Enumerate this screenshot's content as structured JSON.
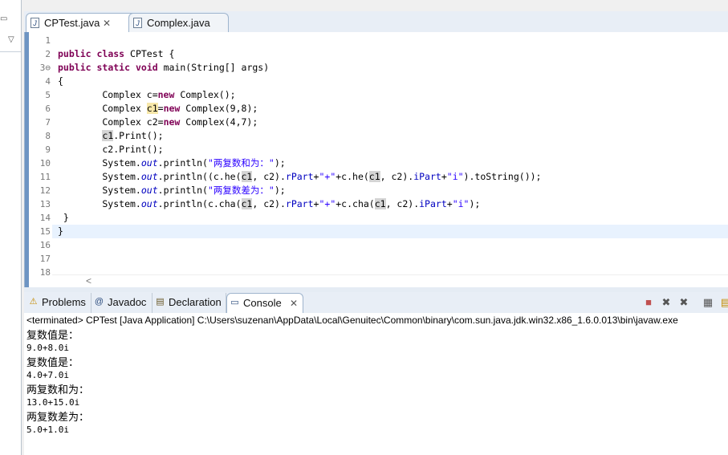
{
  "editor_tabs": [
    {
      "label": "CPTest.java",
      "active": true,
      "close": "✕"
    },
    {
      "label": "Complex.java",
      "active": false
    }
  ],
  "code_lines": [
    {
      "n": "1"
    },
    {
      "n": "2"
    },
    {
      "n": "3⊖"
    },
    {
      "n": "4"
    },
    {
      "n": "5"
    },
    {
      "n": "6"
    },
    {
      "n": "7"
    },
    {
      "n": "8"
    },
    {
      "n": "9"
    },
    {
      "n": "10"
    },
    {
      "n": "11"
    },
    {
      "n": "12"
    },
    {
      "n": "13"
    },
    {
      "n": "14"
    },
    {
      "n": "15"
    },
    {
      "n": "16"
    },
    {
      "n": "17"
    },
    {
      "n": "18"
    }
  ],
  "code": {
    "l2": [
      "public",
      " ",
      "class",
      " CPTest {"
    ],
    "l3": [
      "public",
      " ",
      "static",
      " ",
      "void",
      " main(String[] args)"
    ],
    "l4": "{",
    "l5": [
      "        Complex c=",
      "new",
      " Complex();"
    ],
    "l6": [
      "        Complex ",
      "c1",
      "=",
      "new",
      " Complex(9,8);"
    ],
    "l7": [
      "        Complex c2=",
      "new",
      " Complex(4,7);"
    ],
    "l8": [
      "        ",
      "c1",
      ".Print();"
    ],
    "l9": "        c2.Print();",
    "l10": [
      "        System.",
      "out",
      ".println(",
      "\"两复数和为：\"",
      ");"
    ],
    "l11": [
      "        System.",
      "out",
      ".println((c.he(",
      "c1",
      ", c2).",
      "rPart",
      "+",
      "\"+\"",
      "+c.he(",
      "c1",
      ", c2).",
      "iPart",
      "+",
      "\"i\"",
      ").toString());"
    ],
    "l12": [
      "        System.",
      "out",
      ".println(",
      "\"两复数差为：\"",
      ");"
    ],
    "l13": [
      "        System.",
      "out",
      ".println(c.cha(",
      "c1",
      ", c2).",
      "rPart",
      "+",
      "\"+\"",
      "+c.cha(",
      "c1",
      ", c2).",
      "iPart",
      "+",
      "\"i\"",
      ");"
    ],
    "l14": " }",
    "l15": "}"
  },
  "scroll_marker": "<",
  "console_tabs": [
    {
      "label": "Problems",
      "icon": "problems-icon",
      "glyph": "⚠"
    },
    {
      "label": "Javadoc",
      "icon": "javadoc-icon",
      "glyph": "@"
    },
    {
      "label": "Declaration",
      "icon": "declaration-icon",
      "glyph": "▤"
    },
    {
      "label": "Console",
      "icon": "console-icon",
      "glyph": "▭",
      "active": true,
      "close": "✕"
    }
  ],
  "console": {
    "header": "<terminated> CPTest [Java Application] C:\\Users\\suzenan\\AppData\\Local\\Genuitec\\Common\\binary\\com.sun.java.jdk.win32.x86_1.6.0.013\\bin\\javaw.exe",
    "lines": [
      "复数值是：",
      "9.0+8.0i",
      "复数值是：",
      "4.0+7.0i",
      "两复数和为：",
      "13.0+15.0i",
      "两复数差为：",
      "5.0+1.0i"
    ]
  },
  "colors": {
    "keyword": "#7f0055",
    "string": "#2a00ff",
    "field": "#0000c0",
    "current_line": "#e8f2fe"
  }
}
